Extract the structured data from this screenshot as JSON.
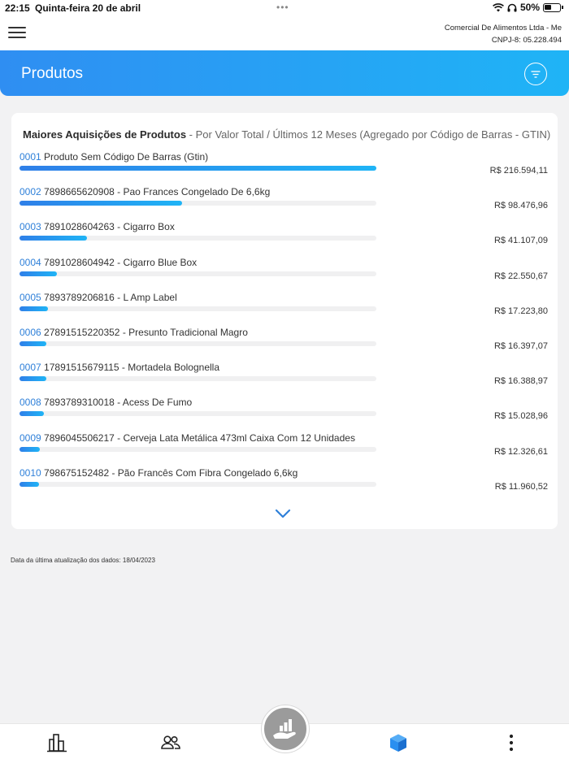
{
  "status_bar": {
    "time": "22:15",
    "date": "Quinta-feira 20 de abril",
    "battery": "50%"
  },
  "header": {
    "company_name": "Comercial De Alimentos Ltda - Me",
    "company_cnpj": "CNPJ-8: 05.228.494"
  },
  "page": {
    "title": "Produtos"
  },
  "card": {
    "title_bold": "Maiores Aquisições de Produtos",
    "title_sub": " - Por Valor Total / Últimos 12 Meses (Agregado por Código de Barras - GTIN)",
    "items": [
      {
        "num": "0001",
        "name": "Produto Sem Código De Barras (Gtin)",
        "value": "R$ 216.594,11",
        "pct": 100
      },
      {
        "num": "0002",
        "name": "7898665620908 - Pao Frances Congelado De 6,6kg",
        "value": "R$ 98.476,96",
        "pct": 45.5
      },
      {
        "num": "0003",
        "name": "7891028604263 - Cigarro Box",
        "value": "R$ 41.107,09",
        "pct": 19
      },
      {
        "num": "0004",
        "name": "7891028604942 - Cigarro Blue Box",
        "value": "R$ 22.550,67",
        "pct": 10.4
      },
      {
        "num": "0005",
        "name": "7893789206816 - L Amp Label",
        "value": "R$ 17.223,80",
        "pct": 8
      },
      {
        "num": "0006",
        "name": "27891515220352 - Presunto Tradicional Magro",
        "value": "R$ 16.397,07",
        "pct": 7.6
      },
      {
        "num": "0007",
        "name": "17891515679115 - Mortadela Bolognella",
        "value": "R$ 16.388,97",
        "pct": 7.6
      },
      {
        "num": "0008",
        "name": "7893789310018 - Acess De Fumo",
        "value": "R$ 15.028,96",
        "pct": 6.9
      },
      {
        "num": "0009",
        "name": "7896045506217 - Cerveja Lata Metálica 473ml Caixa Com 12 Unidades",
        "value": "R$ 12.326,61",
        "pct": 5.7
      },
      {
        "num": "0010",
        "name": "798675152482 - Pão Francês Com Fibra Congelado 6,6kg",
        "value": "R$ 11.960,52",
        "pct": 5.5
      }
    ]
  },
  "footer": {
    "update_text": "Data da última atualização dos dados: 18/04/2023"
  },
  "colors": {
    "accent": "#2f8ef2",
    "accent_end": "#1fb4f6",
    "active_nav": "#2a8ff0"
  }
}
